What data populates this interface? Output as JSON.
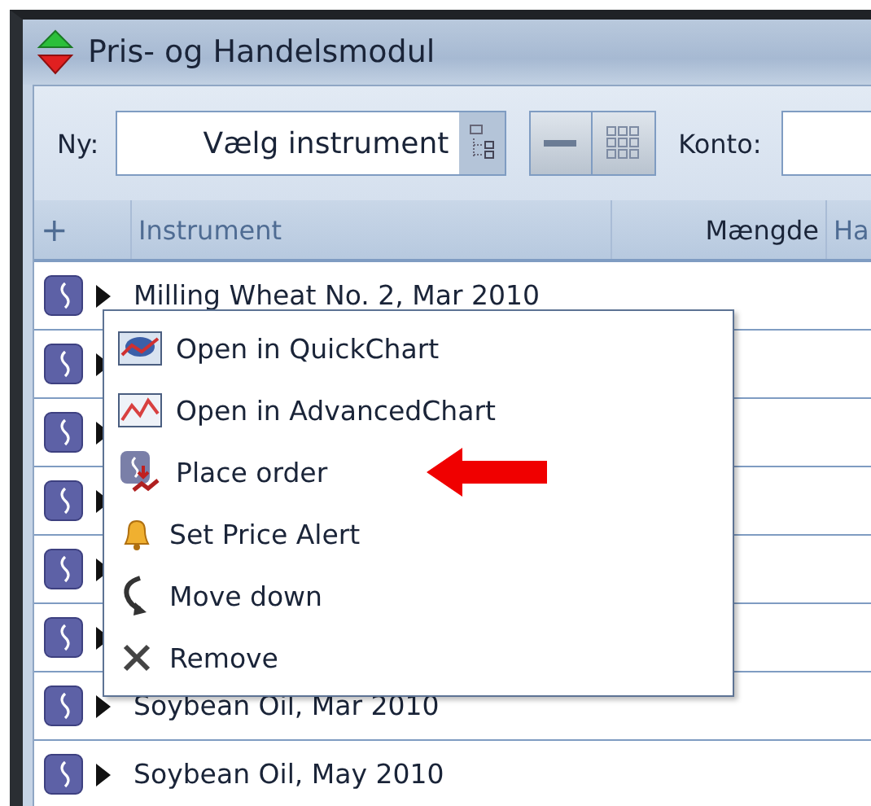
{
  "window": {
    "title": "Pris- og Handelsmodul"
  },
  "toolbar": {
    "new_label": "Ny:",
    "instrument_field": {
      "value": "Vælg instrument"
    },
    "account_label": "Konto:"
  },
  "table": {
    "columns": [
      "+",
      "Instrument",
      "Mængde",
      "Ha"
    ],
    "rows": [
      {
        "instrument": "Milling Wheat No. 2, Mar 2010"
      },
      {},
      {},
      {},
      {},
      {},
      {
        "instrument": "Soybean Oil, Mar 2010"
      },
      {
        "instrument": "Soybean Oil, May 2010"
      }
    ]
  },
  "context_menu": {
    "items": [
      {
        "label": "Open in QuickChart",
        "kind": "quickchart",
        "marked": false
      },
      {
        "label": "Open in AdvancedChart",
        "kind": "advancedchart",
        "marked": false
      },
      {
        "label": "Place order",
        "kind": "order",
        "marked": true
      },
      {
        "label": "Set Price Alert",
        "kind": "alert",
        "marked": false
      },
      {
        "label": "Move down",
        "kind": "move",
        "marked": false
      },
      {
        "label": "Remove",
        "kind": "remove",
        "marked": false
      }
    ]
  }
}
